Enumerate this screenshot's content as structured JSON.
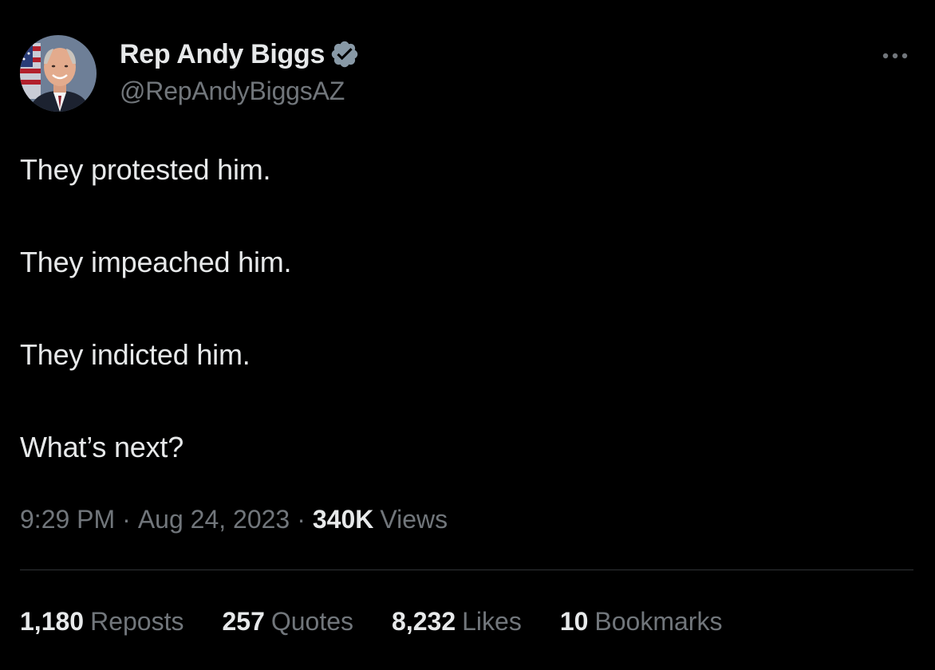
{
  "author": {
    "display_name": "Rep Andy Biggs",
    "handle": "@RepAndyBiggsAZ",
    "verified": true,
    "verified_color": "#8899a6",
    "avatar_icon": "person-photo-with-flag"
  },
  "menu": {
    "icon": "more-horizontal-icon"
  },
  "tweet": {
    "lines": [
      "They protested him.",
      "They impeached him.",
      "They indicted him.",
      "What’s next?"
    ]
  },
  "meta": {
    "time": "9:29 PM",
    "separator": "·",
    "date": "Aug 24, 2023",
    "views_count": "340K",
    "views_label": "Views"
  },
  "stats": {
    "reposts_count": "1,180",
    "reposts_label": "Reposts",
    "quotes_count": "257",
    "quotes_label": "Quotes",
    "likes_count": "8,232",
    "likes_label": "Likes",
    "bookmarks_count": "10",
    "bookmarks_label": "Bookmarks"
  },
  "colors": {
    "background": "#000000",
    "primary_text": "#e7e9ea",
    "secondary_text": "#71767b",
    "divider": "#2f3336"
  }
}
